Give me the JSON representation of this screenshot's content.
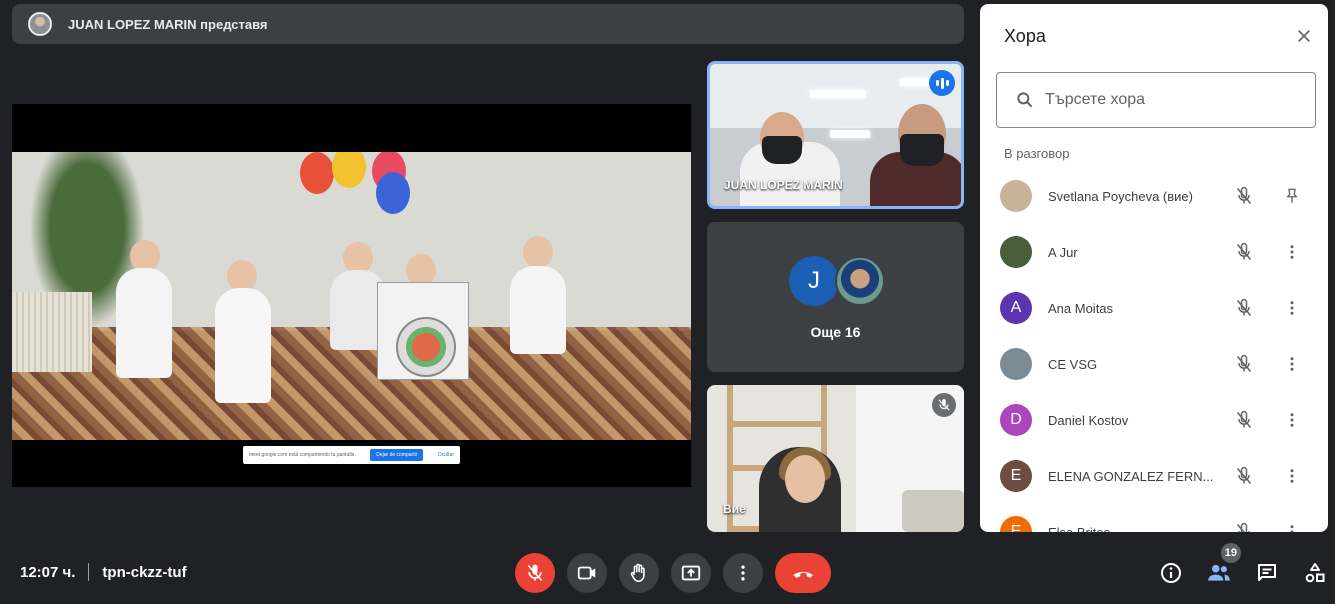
{
  "banner": {
    "presenter_text": "JUAN LOPEZ MARIN представя"
  },
  "shared_screen": {
    "notice_text": "meet.google.com está compartiendo tu pantalla.",
    "stop_button": "Dejar de compartir",
    "hide_link": "Ocultar"
  },
  "tiles": {
    "speaker_name": "JUAN LOPEZ MARIN",
    "more": {
      "avatar_letter": "J",
      "label": "Още 16"
    },
    "self_name": "Вие"
  },
  "people_panel": {
    "title": "Хора",
    "search_placeholder": "Търсете хора",
    "section_label": "В разговор",
    "participants": [
      {
        "name": "Svetlana Poycheva (вие)",
        "initial": "",
        "color": "#c9b29a",
        "action": "pin-icon"
      },
      {
        "name": "A Jur",
        "initial": "",
        "color": "#4b5d3a",
        "action": "more-vert-icon"
      },
      {
        "name": "Ana Moitas",
        "initial": "A",
        "color": "#5e35b1",
        "action": "more-vert-icon"
      },
      {
        "name": "CE VSG",
        "initial": "",
        "color": "#7a8b96",
        "action": "more-vert-icon"
      },
      {
        "name": "Daniel Kostov",
        "initial": "D",
        "color": "#ab47bc",
        "action": "more-vert-icon"
      },
      {
        "name": "ELENA GONZALEZ FERN...",
        "initial": "E",
        "color": "#6d4c41",
        "action": "more-vert-icon"
      },
      {
        "name": "Elsa Brites",
        "initial": "E",
        "color": "#ef6c00",
        "action": "more-vert-icon"
      }
    ]
  },
  "bottom_bar": {
    "time": "12:07 ч.",
    "meeting_code": "tpn-ckzz-tuf",
    "participant_count": "19"
  },
  "colors": {
    "background": "#202124",
    "leave_red": "#ea4335",
    "accent_blue": "#1a73e8"
  }
}
